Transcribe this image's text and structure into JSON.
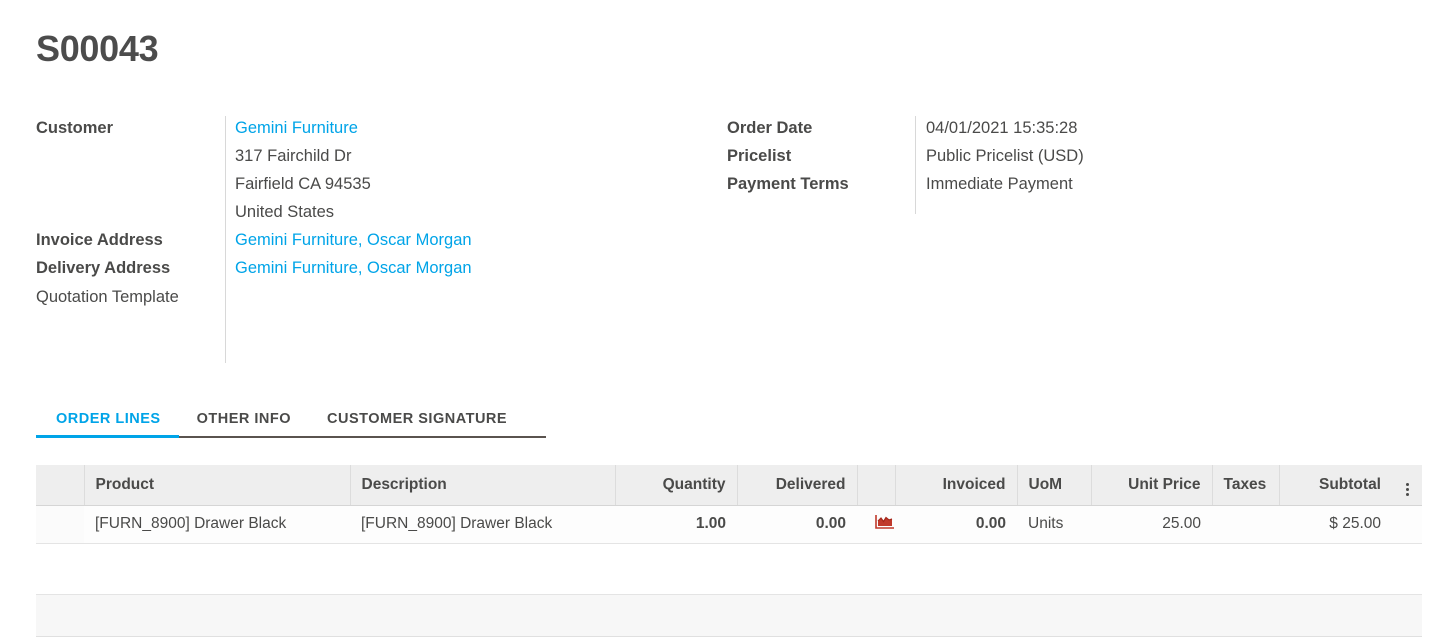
{
  "record": {
    "title": "S00043"
  },
  "form": {
    "left": [
      {
        "label": "Customer",
        "bold": true,
        "lines": [
          {
            "text": "Gemini Furniture",
            "link": true
          },
          {
            "text": "317 Fairchild Dr",
            "link": false
          },
          {
            "text": "Fairfield CA 94535",
            "link": false
          },
          {
            "text": "United States",
            "link": false
          }
        ]
      },
      {
        "label": "Invoice Address",
        "bold": true,
        "lines": [
          {
            "text": "Gemini Furniture, Oscar Morgan",
            "link": true
          }
        ]
      },
      {
        "label": "Delivery Address",
        "bold": true,
        "lines": [
          {
            "text": "Gemini Furniture, Oscar Morgan",
            "link": true
          }
        ]
      },
      {
        "label": "Quotation Template",
        "bold": false,
        "lines": []
      }
    ],
    "right": [
      {
        "label": "Order Date",
        "value": "04/01/2021 15:35:28"
      },
      {
        "label": "Pricelist",
        "value": "Public Pricelist (USD)"
      },
      {
        "label": "Payment Terms",
        "value": "Immediate Payment"
      }
    ]
  },
  "tabs": [
    {
      "label": "ORDER LINES",
      "active": true
    },
    {
      "label": "OTHER INFO",
      "active": false
    },
    {
      "label": "CUSTOMER SIGNATURE",
      "active": false
    }
  ],
  "order_lines": {
    "columns": [
      "Product",
      "Description",
      "Quantity",
      "Delivered",
      "",
      "Invoiced",
      "UoM",
      "Unit Price",
      "Taxes",
      "Subtotal"
    ],
    "optional_columns_icon": "kebab-menu-icon",
    "rows": [
      {
        "product": "[FURN_8900] Drawer Black",
        "description": "[FURN_8900] Drawer Black",
        "quantity": "1.00",
        "delivered": "0.00",
        "delivered_icon": "area-chart-icon",
        "invoiced": "0.00",
        "uom": "Units",
        "unit_price": "25.00",
        "taxes": "",
        "subtotal": "$ 25.00"
      }
    ]
  },
  "colors": {
    "accent": "#00a4e8",
    "text": "#4a4a49",
    "header_bg": "#eeeeee",
    "icon_red": "#c0392b"
  }
}
